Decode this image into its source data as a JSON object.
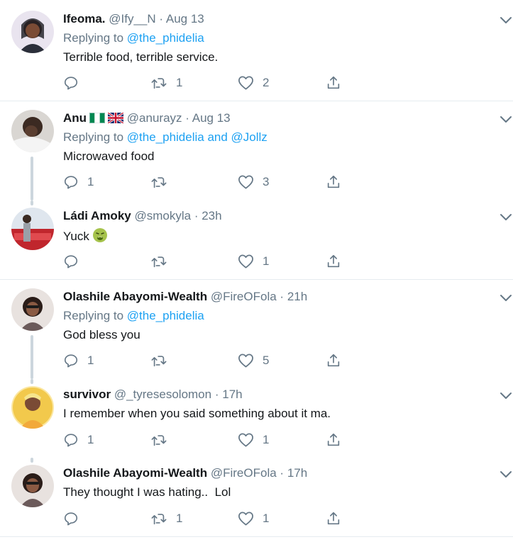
{
  "tweets": [
    {
      "name": "Ifeoma.",
      "handle": "@Ify__N",
      "dot": "·",
      "time": "Aug 13",
      "replying_prefix": "Replying to ",
      "replying_to": "@the_phidelia",
      "text": "Terrible food, terrible service.",
      "replies": "",
      "retweets": "1",
      "likes": "2",
      "avatar_color": "#2b2f3a"
    },
    {
      "name": "Anu",
      "flags": [
        "nigeria-flag",
        "uk-flag"
      ],
      "handle": "@anurayz",
      "dot": "·",
      "time": "Aug 13",
      "replying_prefix": "Replying to ",
      "replying_to": "@the_phidelia and @Jollz",
      "text": "Microwaved food",
      "replies": "1",
      "retweets": "",
      "likes": "3",
      "avatar_color": "#5a4f4a"
    },
    {
      "name": "Ládi Amoky",
      "handle": "@smokyla",
      "dot": "·",
      "time": "23h",
      "text": "Yuck",
      "text_emoji": "nauseated-face-icon",
      "replies": "",
      "retweets": "",
      "likes": "1",
      "avatar_color": "#c0262d"
    },
    {
      "name": "Olashile Abayomi-Wealth",
      "handle": "@FireOFola",
      "dot": "·",
      "time": "21h",
      "replying_prefix": "Replying to ",
      "replying_to": "@the_phidelia",
      "text": "God bless you",
      "replies": "1",
      "retweets": "",
      "likes": "5",
      "avatar_color": "#6b5a5a"
    },
    {
      "name": "survivor",
      "handle": "@_tyresesolomon",
      "dot": "·",
      "time": "17h",
      "text": "I remember when you said something about it ma.",
      "replies": "1",
      "retweets": "",
      "likes": "1",
      "avatar_color": "#f2c94c"
    },
    {
      "name": "Olashile Abayomi-Wealth",
      "handle": "@FireOFola",
      "dot": "·",
      "time": "17h",
      "text": "They thought I was hating..  Lol",
      "replies": "",
      "retweets": "1",
      "likes": "1",
      "avatar_color": "#6b5a5a"
    }
  ],
  "colors": {
    "link": "#1da1f2",
    "muted": "#657786",
    "separator": "#e6ecf0",
    "thread_line": "#ccd6dd"
  }
}
